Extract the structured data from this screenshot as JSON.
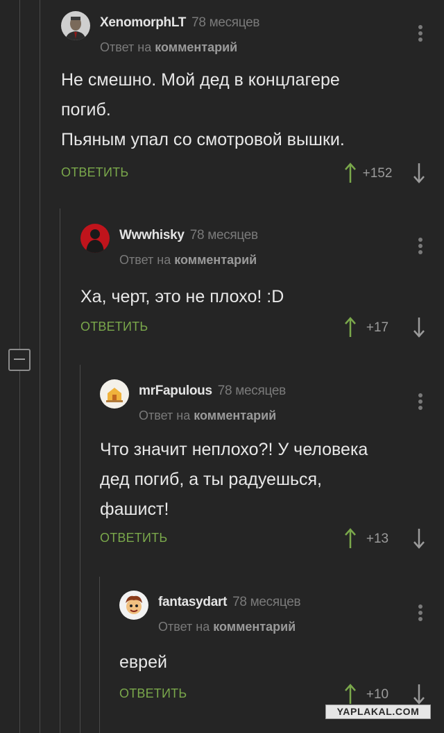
{
  "collapse_label": "−",
  "watermark": "YAPLAKAL.COM",
  "comments": [
    {
      "username": "XenomorphLT",
      "time": "78 месяцев",
      "reply_prefix": "Ответ на",
      "reply_target": "комментарий",
      "text_lines": [
        "Не смешно. Мой дед в концлагере",
        "погиб.",
        "Пьяным упал со смотровой вышки."
      ],
      "reply_label": "Ответить",
      "score": "+152",
      "avatar": "man-in-suit-avatar"
    },
    {
      "username": "Wwwhisky",
      "time": "78 месяцев",
      "reply_prefix": "Ответ на",
      "reply_target": "комментарий",
      "text_lines": [
        "Ха, черт, это не плохо! :D"
      ],
      "reply_label": "Ответить",
      "score": "+17",
      "avatar": "red-silhouette-avatar"
    },
    {
      "username": "mrFapulous",
      "time": "78 месяцев",
      "reply_prefix": "Ответ на",
      "reply_target": "комментарий",
      "text_lines": [
        "Что значит неплохо?! У человека",
        "дед погиб, а ты радуешься,",
        "фашист!"
      ],
      "reply_label": "Ответить",
      "score": "+13",
      "avatar": "cartoon-house-avatar"
    },
    {
      "username": "fantasydart",
      "time": "78 месяцев",
      "reply_prefix": "Ответ на",
      "reply_target": "комментарий",
      "text_lines": [
        "еврей"
      ],
      "reply_label": "Ответить",
      "score": "+10",
      "avatar": "cartoon-face-avatar"
    }
  ]
}
